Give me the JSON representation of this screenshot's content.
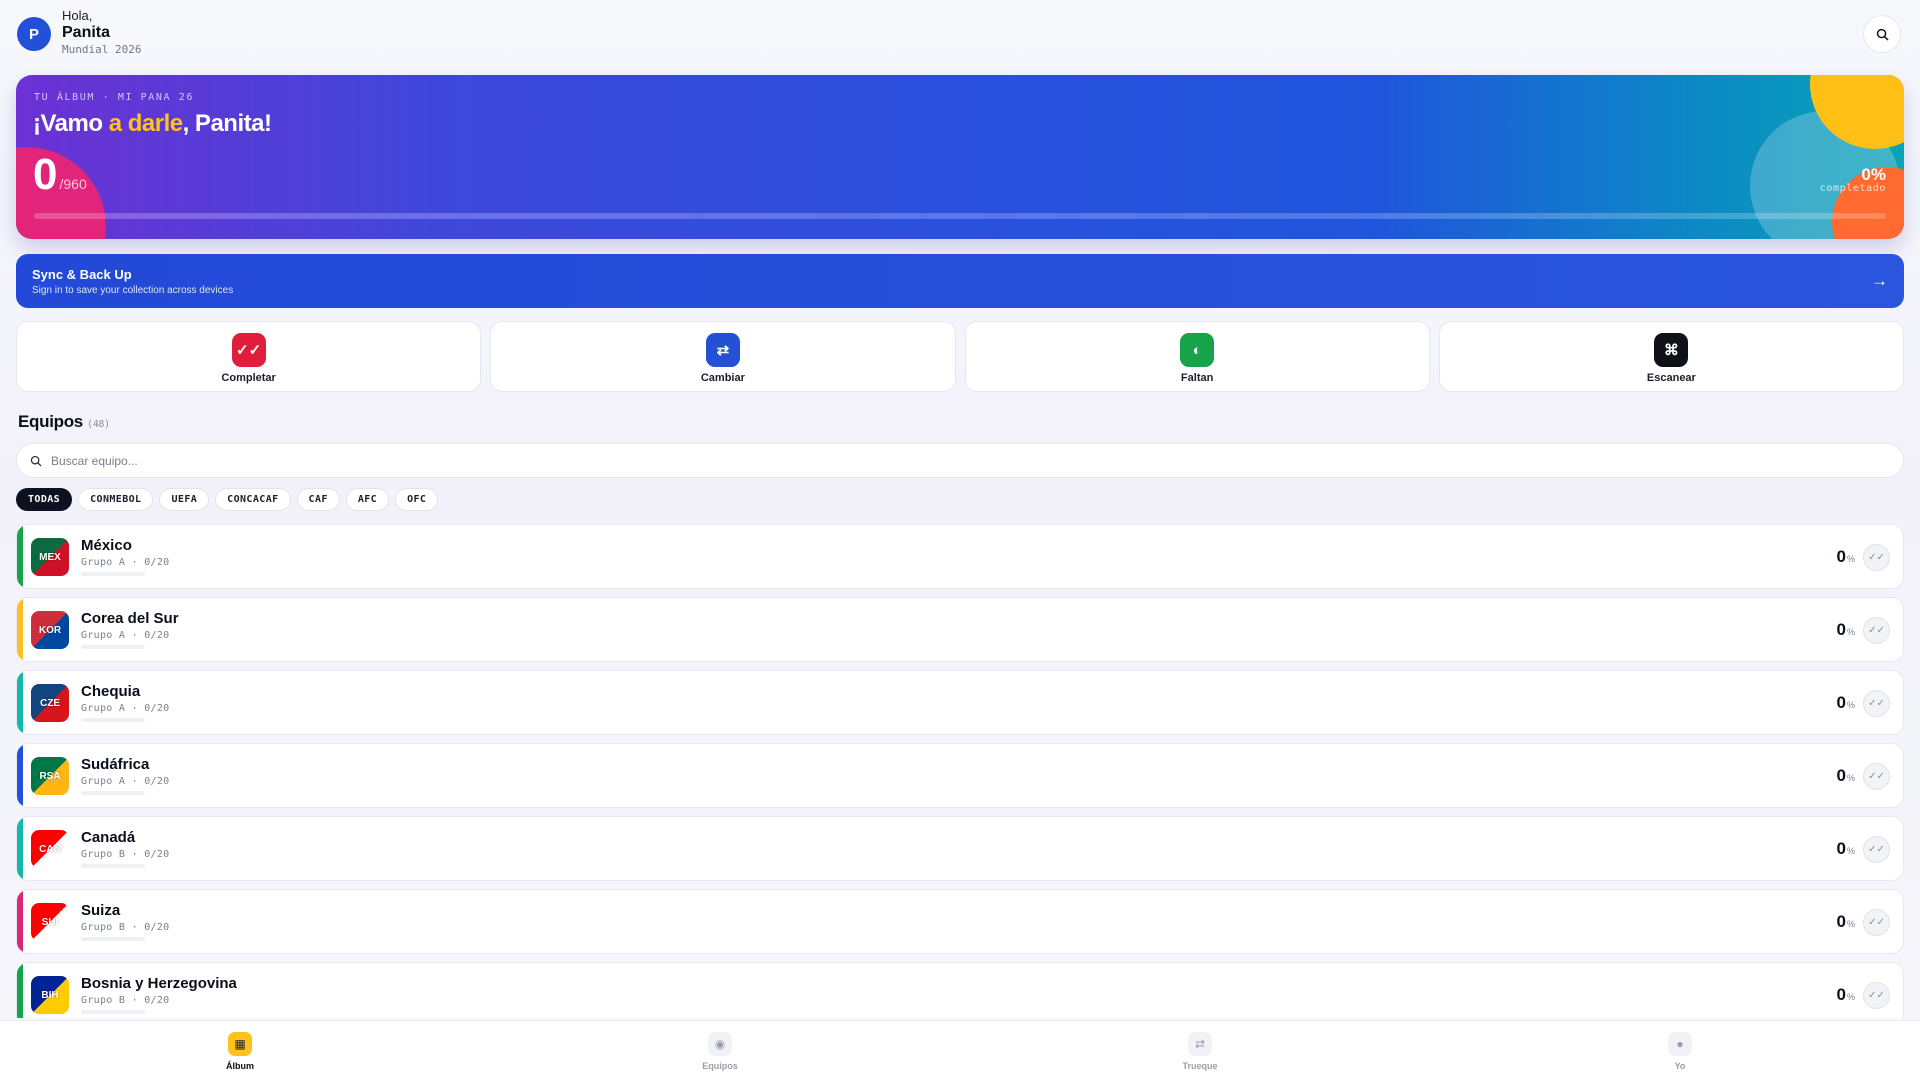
{
  "header": {
    "avatar_letter": "P",
    "greeting": "Hola,",
    "user_name": "Panita",
    "tournament": "Mundial 2026"
  },
  "hero": {
    "kicker": "TU ÁLBUM · MI PANA 26",
    "title_part1": "¡Vamo ",
    "title_highlight": "a darle",
    "title_part2": ", Panita!",
    "collected": "0",
    "total": "/960",
    "percent": "0%",
    "percent_label": "completado",
    "progress": 0
  },
  "sync": {
    "title": "Sync & Back Up",
    "subtitle": "Sign in to save your collection across devices",
    "arrow": "→"
  },
  "actions": [
    {
      "label": "Completar",
      "icon": "✓✓",
      "icon_name": "double-check-icon",
      "color": "#e11d3c"
    },
    {
      "label": "Cambiar",
      "icon": "⇄",
      "icon_name": "swap-icon",
      "color": "#2450d6"
    },
    {
      "label": "Faltan",
      "icon": "◐",
      "icon_name": "half-circle-icon",
      "color": "#16a34a"
    },
    {
      "label": "Escanear",
      "icon": "⌘",
      "icon_name": "scan-icon",
      "color": "#0e1116"
    }
  ],
  "teams_section": {
    "title": "Equipos",
    "count": "(48)",
    "search_placeholder": "Buscar equipo..."
  },
  "filters": [
    "TODAS",
    "CONMEBOL",
    "UEFA",
    "CONCACAF",
    "CAF",
    "AFC",
    "OFC"
  ],
  "active_filter": "TODAS",
  "teams": [
    {
      "name": "México",
      "code": "MEX",
      "meta": "Grupo A · 0/20",
      "pct": "0",
      "stripe": "#16a34a",
      "flag": [
        "#0c6b3e",
        "#ce1126"
      ]
    },
    {
      "name": "Corea del Sur",
      "code": "KOR",
      "meta": "Grupo A · 0/20",
      "pct": "0",
      "stripe": "#fbbf24",
      "flag": [
        "#cd2e3a",
        "#0047a0"
      ]
    },
    {
      "name": "Chequia",
      "code": "CZE",
      "meta": "Grupo A · 0/20",
      "pct": "0",
      "stripe": "#14b8a6",
      "flag": [
        "#11457e",
        "#d7141a"
      ]
    },
    {
      "name": "Sudáfrica",
      "code": "RSA",
      "meta": "Grupo A · 0/20",
      "pct": "0",
      "stripe": "#2350d8",
      "flag": [
        "#007749",
        "#ffb612"
      ]
    },
    {
      "name": "Canadá",
      "code": "CAN",
      "meta": "Grupo B · 0/20",
      "pct": "0",
      "stripe": "#14b8a6",
      "flag": [
        "#ff0000",
        "#ffffff"
      ]
    },
    {
      "name": "Suiza",
      "code": "SUI",
      "meta": "Grupo B · 0/20",
      "pct": "0",
      "stripe": "#db2777",
      "flag": [
        "#ff0000",
        "#ffffff"
      ]
    },
    {
      "name": "Bosnia y Herzegovina",
      "code": "BIH",
      "meta": "Grupo B · 0/20",
      "pct": "0",
      "stripe": "#16a34a",
      "flag": [
        "#002395",
        "#fecb00"
      ]
    }
  ],
  "percent_sign": "%",
  "check_glyph": "✓✓",
  "nav": [
    {
      "label": "Álbum",
      "icon": "▦",
      "icon_name": "album-icon",
      "active": true
    },
    {
      "label": "Equipos",
      "icon": "◉",
      "icon_name": "teams-icon",
      "active": false
    },
    {
      "label": "Trueque",
      "icon": "⇄",
      "icon_name": "trade-icon",
      "active": false
    },
    {
      "label": "Yo",
      "icon": "●",
      "icon_name": "profile-icon",
      "active": false
    }
  ]
}
